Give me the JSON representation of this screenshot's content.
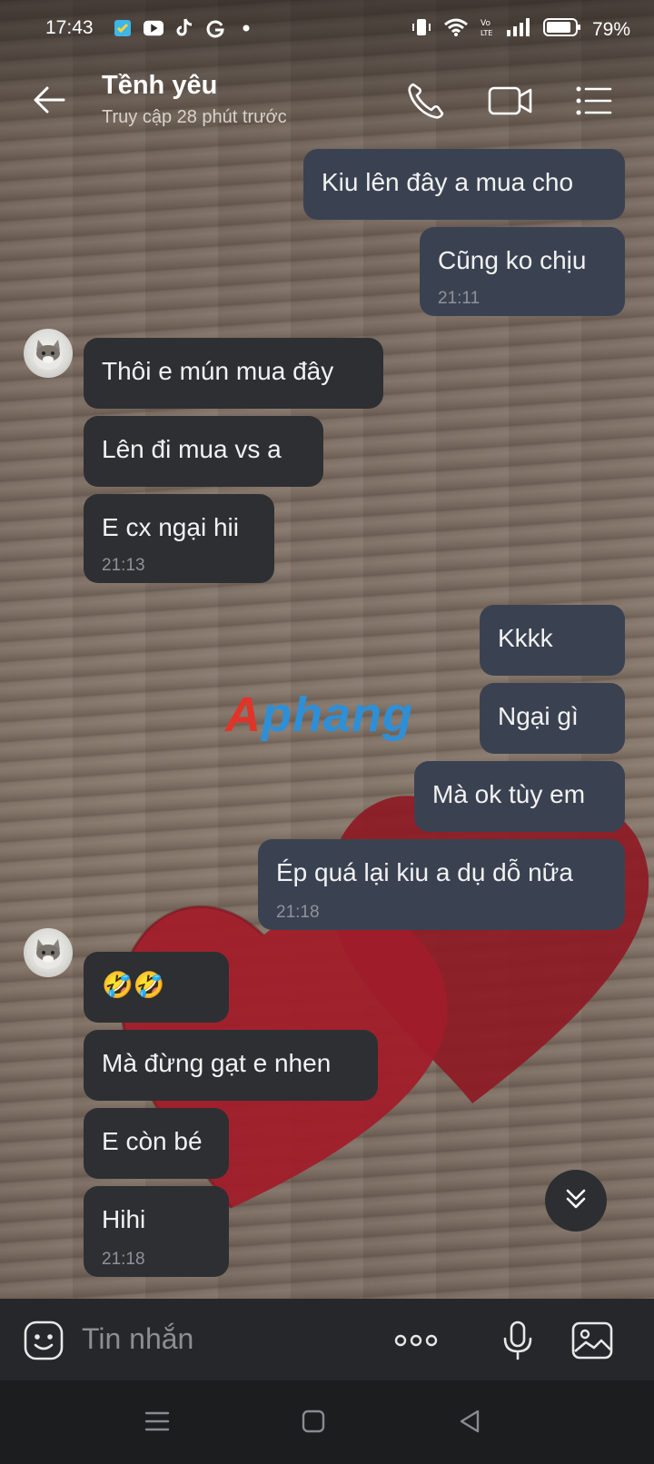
{
  "status_bar": {
    "time": "17:43",
    "battery_percent": "79%",
    "app_icons": [
      "security-app-icon",
      "youtube-icon",
      "tiktok-icon",
      "google-icon",
      "dot-icon"
    ],
    "right_icons": [
      "vibrate-icon",
      "wifi-icon",
      "volte-icon",
      "signal-icon",
      "battery-icon"
    ]
  },
  "header": {
    "contact_name": "Tềnh yêu",
    "last_seen": "Truy cập 28 phút trước"
  },
  "watermark": {
    "part1": "A",
    "part2": "phang"
  },
  "messages": [
    {
      "dir": "out",
      "text": "Kiu lên đây a mua cho",
      "time": ""
    },
    {
      "dir": "out",
      "text": "Cũng ko chịu",
      "time": "21:11"
    },
    {
      "dir": "in",
      "text": "Thôi e mún mua đây",
      "time": ""
    },
    {
      "dir": "in",
      "text": "Lên đi mua vs a",
      "time": ""
    },
    {
      "dir": "in",
      "text": "E cx ngại hii",
      "time": "21:13"
    },
    {
      "dir": "out",
      "text": "Kkkk",
      "time": ""
    },
    {
      "dir": "out",
      "text": "Ngại gì",
      "time": ""
    },
    {
      "dir": "out",
      "text": "Mà ok tùy em",
      "time": ""
    },
    {
      "dir": "out",
      "text": "Ép quá lại kiu a dụ dỗ nữa",
      "time": "21:18"
    },
    {
      "dir": "in",
      "text": "🤣🤣",
      "time": ""
    },
    {
      "dir": "in",
      "text": "Mà đừng gạt e nhen",
      "time": ""
    },
    {
      "dir": "in",
      "text": "E còn bé",
      "time": ""
    },
    {
      "dir": "in",
      "text": "Hihi",
      "time": "21:18"
    }
  ],
  "composer": {
    "placeholder": "Tin nhắn"
  },
  "colors": {
    "outgoing_bubble": "#3a4252",
    "incoming_bubble": "#2e2f33",
    "timestamp": "#8d939c"
  }
}
